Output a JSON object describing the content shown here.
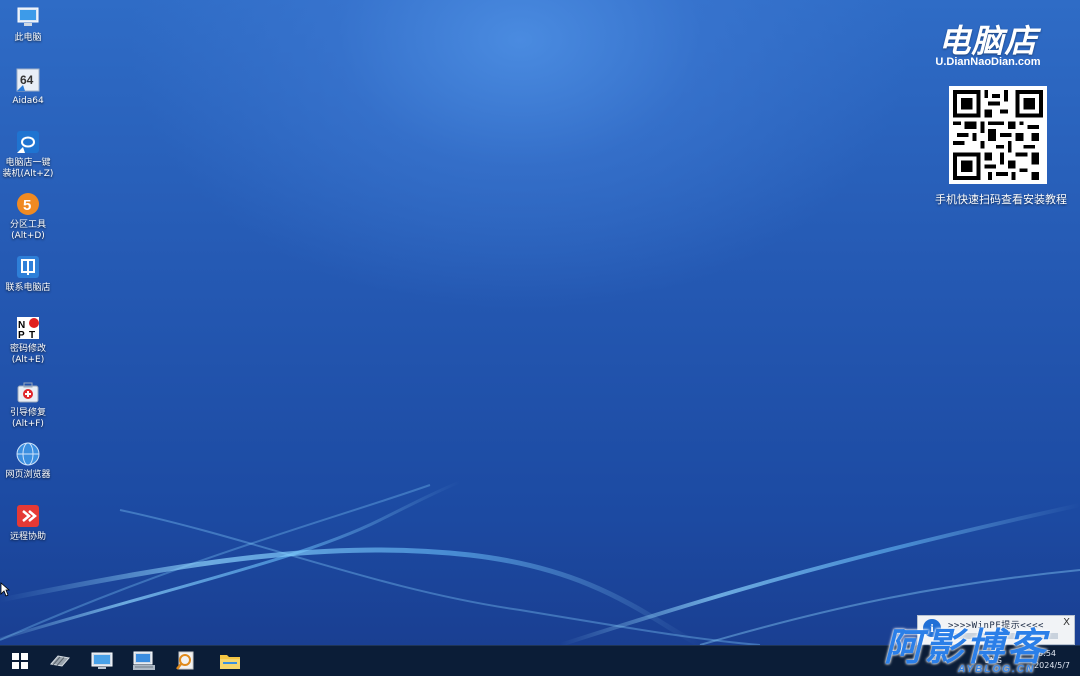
{
  "desktop": {
    "icons": [
      {
        "name": "this-pc",
        "label": "此电脑"
      },
      {
        "name": "aida64",
        "label": "Aida64"
      },
      {
        "name": "one-click-install",
        "label": "电脑店一键\n装机(Alt+Z)"
      },
      {
        "name": "partition-tool",
        "label": "分区工具\n(Alt+D)"
      },
      {
        "name": "contact-store",
        "label": "联系电脑店"
      },
      {
        "name": "password-reset",
        "label": "密码修改\n(Alt+E)"
      },
      {
        "name": "boot-repair",
        "label": "引导修复\n(Alt+F)"
      },
      {
        "name": "web-browser",
        "label": "网页浏览器"
      },
      {
        "name": "remote-assist",
        "label": "远程协助"
      }
    ]
  },
  "brand": {
    "title": "电脑店",
    "domain": "U.DianNaoDian.com",
    "qr_caption": "手机快速扫码查看安装教程"
  },
  "notification": {
    "text": ">>>>WinPE提示<<<<",
    "close": "X"
  },
  "taskbar": {
    "apps": [
      {
        "name": "start",
        "icon": "windows-logo-icon"
      },
      {
        "name": "hardware",
        "icon": "memory-chip-icon"
      },
      {
        "name": "this-pc",
        "icon": "monitor-icon"
      },
      {
        "name": "network",
        "icon": "network-computer-icon"
      },
      {
        "name": "disk-search",
        "icon": "disk-search-icon"
      },
      {
        "name": "file-explorer",
        "icon": "folder-icon"
      }
    ],
    "tray": {
      "lang": "ENG",
      "time": "0:54",
      "date": "2024/5/7"
    }
  },
  "watermark": {
    "big": "阿影博客",
    "small": "AYBLOG.CN"
  },
  "colors": {
    "desktop_top": "#2f6cc6",
    "desktop_bottom": "#1a3f92",
    "taskbar": "#0b1d37",
    "accent": "#2b7fe8"
  }
}
